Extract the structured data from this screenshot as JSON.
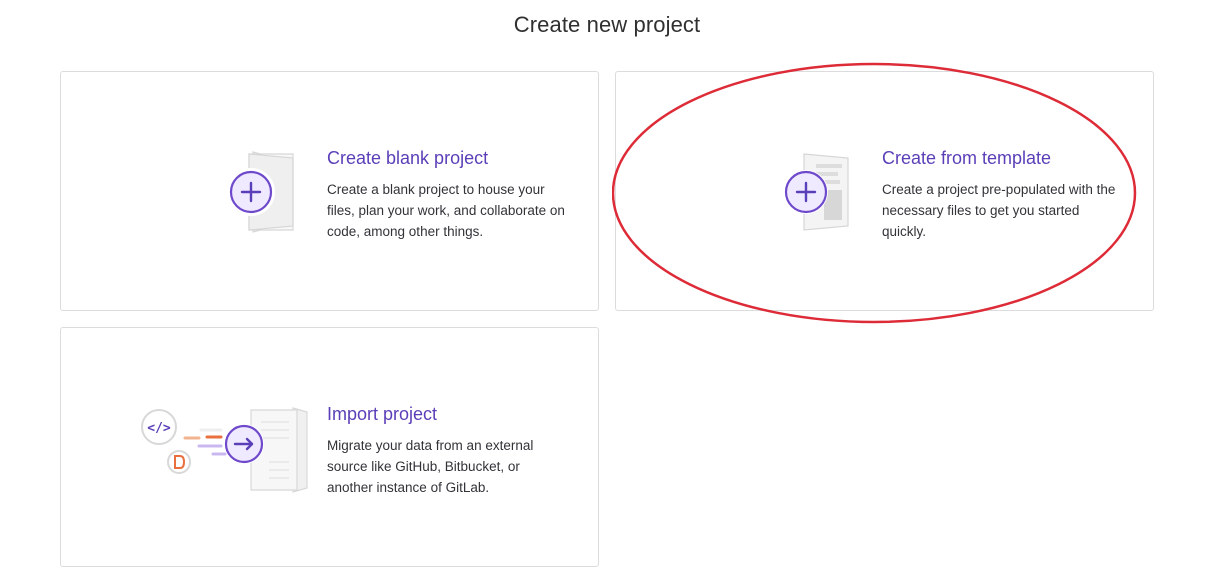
{
  "page": {
    "title": "Create new project"
  },
  "cards": {
    "blank": {
      "title": "Create blank project",
      "description": "Create a blank project to house your files, plan your work, and collaborate on code, among other things.",
      "icon": "blank-project-icon"
    },
    "template": {
      "title": "Create from template",
      "description": "Create a project pre-populated with the necessary files to get you started quickly.",
      "icon": "template-project-icon"
    },
    "import": {
      "title": "Import project",
      "description": "Migrate your data from an external source like GitHub, Bitbucket, or another instance of GitLab.",
      "icon": "import-project-icon"
    }
  },
  "colors": {
    "accent": "#5b3fb8",
    "accent_light": "#efeaff",
    "border": "#dcdcde",
    "annotation": "#dd2b37",
    "orange": "#e9703e"
  }
}
